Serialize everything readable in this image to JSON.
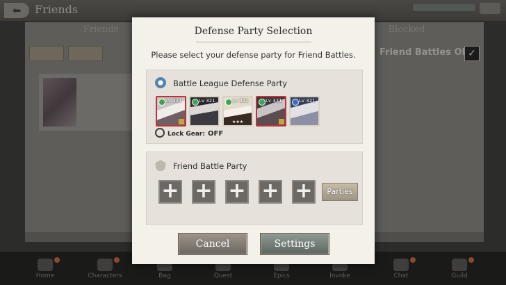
{
  "background": {
    "title": "Friends",
    "tabs": [
      "Friends",
      "Blocked"
    ],
    "friend_battles_label": "Friend Battles ON",
    "nav": [
      {
        "label": "Home",
        "icon": "home-icon"
      },
      {
        "label": "Characters",
        "icon": "characters-icon"
      },
      {
        "label": "Bag",
        "icon": "bag-icon"
      },
      {
        "label": "Quest",
        "icon": "quest-icon"
      },
      {
        "label": "Epics",
        "icon": "epics-icon"
      },
      {
        "label": "Invoke",
        "icon": "invoke-icon"
      },
      {
        "label": "Chat",
        "icon": "chat-icon"
      },
      {
        "label": "Guild",
        "icon": "guild-icon"
      }
    ]
  },
  "dialog": {
    "title": "Defense Party Selection",
    "message": "Please select your defense party for Friend Battles.",
    "league_section": {
      "title": "Battle League Defense Party",
      "heroes": [
        {
          "level": "Lv 321",
          "frame": "red"
        },
        {
          "level": "Lv 321",
          "frame": "plain"
        },
        {
          "level": "Lv 321",
          "frame": "plain",
          "stars": "★★★"
        },
        {
          "level": "Lv 321",
          "frame": "red"
        },
        {
          "level": "Lv 321",
          "frame": "plain"
        }
      ],
      "lock_gear_label": "Lock Gear:",
      "lock_gear_value": "OFF"
    },
    "friend_section": {
      "title": "Friend Battle Party",
      "slot_glyph": "+",
      "parties_label": "Parties"
    },
    "cancel_label": "Cancel",
    "settings_label": "Settings"
  }
}
